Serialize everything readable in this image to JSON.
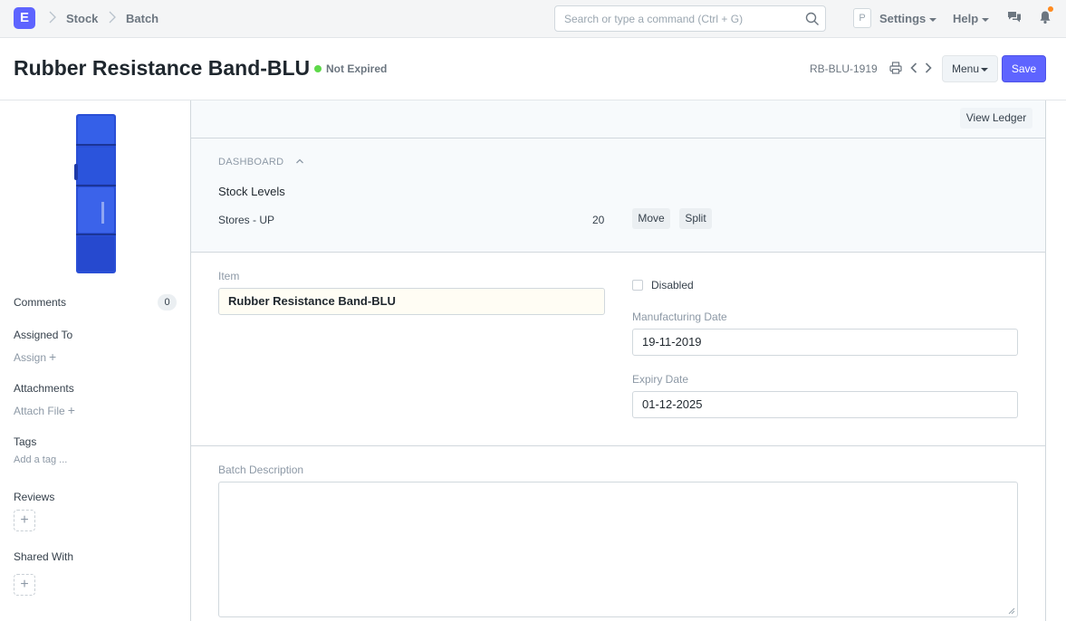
{
  "navbar": {
    "logo_letter": "E",
    "breadcrumbs": [
      "Stock",
      "Batch"
    ],
    "search_placeholder": "Search or type a command (Ctrl + G)",
    "avatar_letter": "P",
    "settings_label": "Settings",
    "help_label": "Help"
  },
  "page": {
    "title": "Rubber Resistance Band-BLU",
    "status": "Not Expired",
    "status_color": "#5ed94a",
    "doc_id": "RB-BLU-1919",
    "menu_label": "Menu",
    "save_label": "Save",
    "accent_color": "#5e64ff"
  },
  "sidebar": {
    "comments_label": "Comments",
    "comments_count": "0",
    "assigned_to_label": "Assigned To",
    "assign_link": "Assign",
    "attachments_label": "Attachments",
    "attach_link": "Attach File",
    "tags_label": "Tags",
    "add_tag_link": "Add a tag ...",
    "reviews_label": "Reviews",
    "shared_with_label": "Shared With"
  },
  "form": {
    "view_ledger_label": "View Ledger",
    "dashboard_label": "DASHBOARD",
    "stock_levels_title": "Stock Levels",
    "warehouse": {
      "name": "Stores - UP",
      "qty": "20",
      "move_label": "Move",
      "split_label": "Split"
    },
    "item_label": "Item",
    "item_value": "Rubber Resistance Band-BLU",
    "disabled_label": "Disabled",
    "disabled_checked": false,
    "manufacturing_date_label": "Manufacturing Date",
    "manufacturing_date_value": "19-11-2019",
    "expiry_date_label": "Expiry Date",
    "expiry_date_value": "01-12-2025",
    "batch_description_label": "Batch Description",
    "batch_description_value": ""
  }
}
